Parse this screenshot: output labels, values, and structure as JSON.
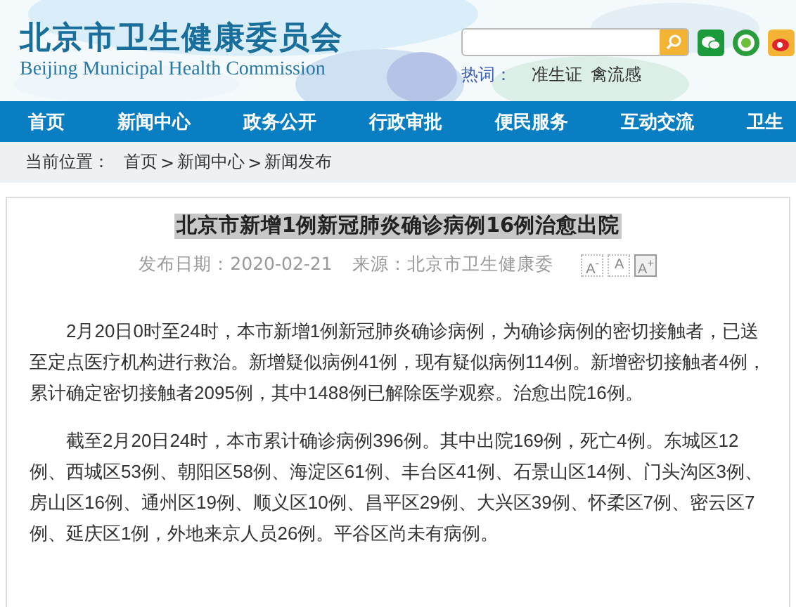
{
  "header": {
    "title": "北京市卫生健康委员会",
    "subtitle": "Beijing Municipal Health Commission",
    "hot_label": "热词：",
    "hot_words": [
      "准生证",
      "禽流感"
    ]
  },
  "nav": [
    "首页",
    "新闻中心",
    "政务公开",
    "行政审批",
    "便民服务",
    "互动交流",
    "卫生"
  ],
  "breadcrumb": {
    "label": "当前位置：",
    "items": [
      "首页",
      "新闻中心",
      "新闻发布"
    ],
    "separator": ">"
  },
  "article": {
    "title": "北京市新增1例新冠肺炎确诊病例16例治愈出院",
    "title_highlighted": true,
    "date": "发布日期：2020-02-21",
    "source": "来源：北京市卫生健康委",
    "font_buttons": [
      "A$^{-}$",
      "A",
      "A$^{+}$"
    ],
    "paragraphs": [
      "2月20日0时至24时，本市新增1例新冠肺炎确诊病例，为确诊病例的密切接触者，已送至定点医疗机构进行救治。新增疑似病例41例，现有疑似病例114例。新增密切接触者4例，累计确定密切接触者2095例，其中1488例已解除医学观察。治愈出院16例。",
      "截至2月20日24时，本市累计确诊病例396例。其中出院169例，死亡4例。东城区12例、西城区53例、朝阳区58例、海淀区61例、丰台区41例、石景山区14例、门头沟区3例、房山区16例、通州区19例、顺义区10例、昌平区29例、大兴区39例、怀柔区7例、密云区7例、延庆区1例，外地来京人员26例。平谷区尚未有病例。"
    ]
  }
}
